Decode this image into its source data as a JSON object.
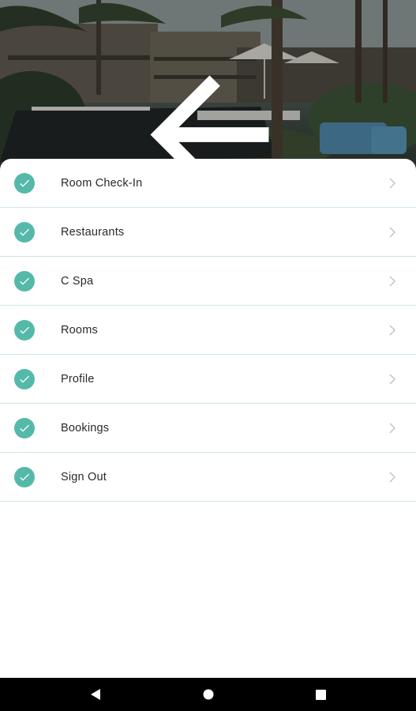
{
  "header": {
    "back_icon": "arrow-left-icon",
    "image": "resort-pool-palm-trees-photo"
  },
  "menu": {
    "accent_color": "#55b9aa",
    "divider_color": "#cfe5e1",
    "items": [
      {
        "label": "Room Check-In",
        "icon": "check-circle-icon"
      },
      {
        "label": "Restaurants",
        "icon": "check-circle-icon"
      },
      {
        "label": "C Spa",
        "icon": "check-circle-icon"
      },
      {
        "label": "Rooms",
        "icon": "check-circle-icon"
      },
      {
        "label": "Profile",
        "icon": "check-circle-icon"
      },
      {
        "label": "Bookings",
        "icon": "check-circle-icon"
      },
      {
        "label": "Sign Out",
        "icon": "check-circle-icon"
      }
    ]
  },
  "nav_bar": {
    "buttons": [
      "back-triangle-icon",
      "home-circle-icon",
      "recents-square-icon"
    ]
  }
}
